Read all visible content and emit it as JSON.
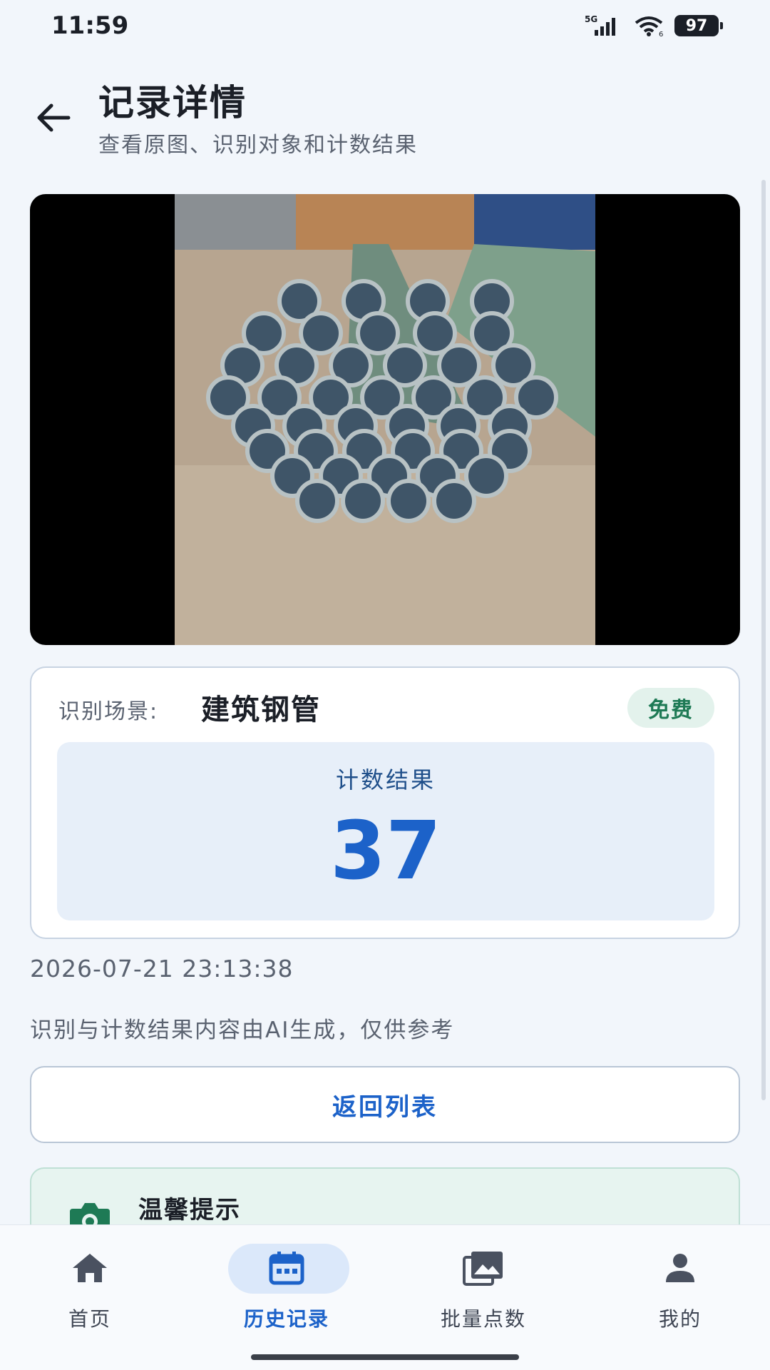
{
  "status_bar": {
    "time": "11:59",
    "network": "5G",
    "battery": "97"
  },
  "header": {
    "title": "记录详情",
    "subtitle": "查看原图、识别对象和计数结果"
  },
  "photo": {
    "subject_icon": "steel-pipes-photo"
  },
  "result": {
    "scene_label": "识别场景:",
    "scene_value": "建筑钢管",
    "badge": "免费",
    "count_label": "计数结果",
    "count_value": "37"
  },
  "timestamp": "2026-07-21 23:13:38",
  "disclaimer": "识别与计数结果内容由AI生成，仅供参考",
  "back_list_button": "返回列表",
  "tip": {
    "title": "温馨提示"
  },
  "nav": {
    "items": [
      {
        "label": "首页",
        "icon": "home-icon"
      },
      {
        "label": "历史记录",
        "icon": "calendar-icon"
      },
      {
        "label": "批量点数",
        "icon": "gallery-icon"
      },
      {
        "label": "我的",
        "icon": "person-icon"
      }
    ],
    "active_index": 1
  },
  "colors": {
    "accent": "#1c62c9",
    "badge_green": "#1e7a55",
    "background": "#f2f6fb"
  }
}
